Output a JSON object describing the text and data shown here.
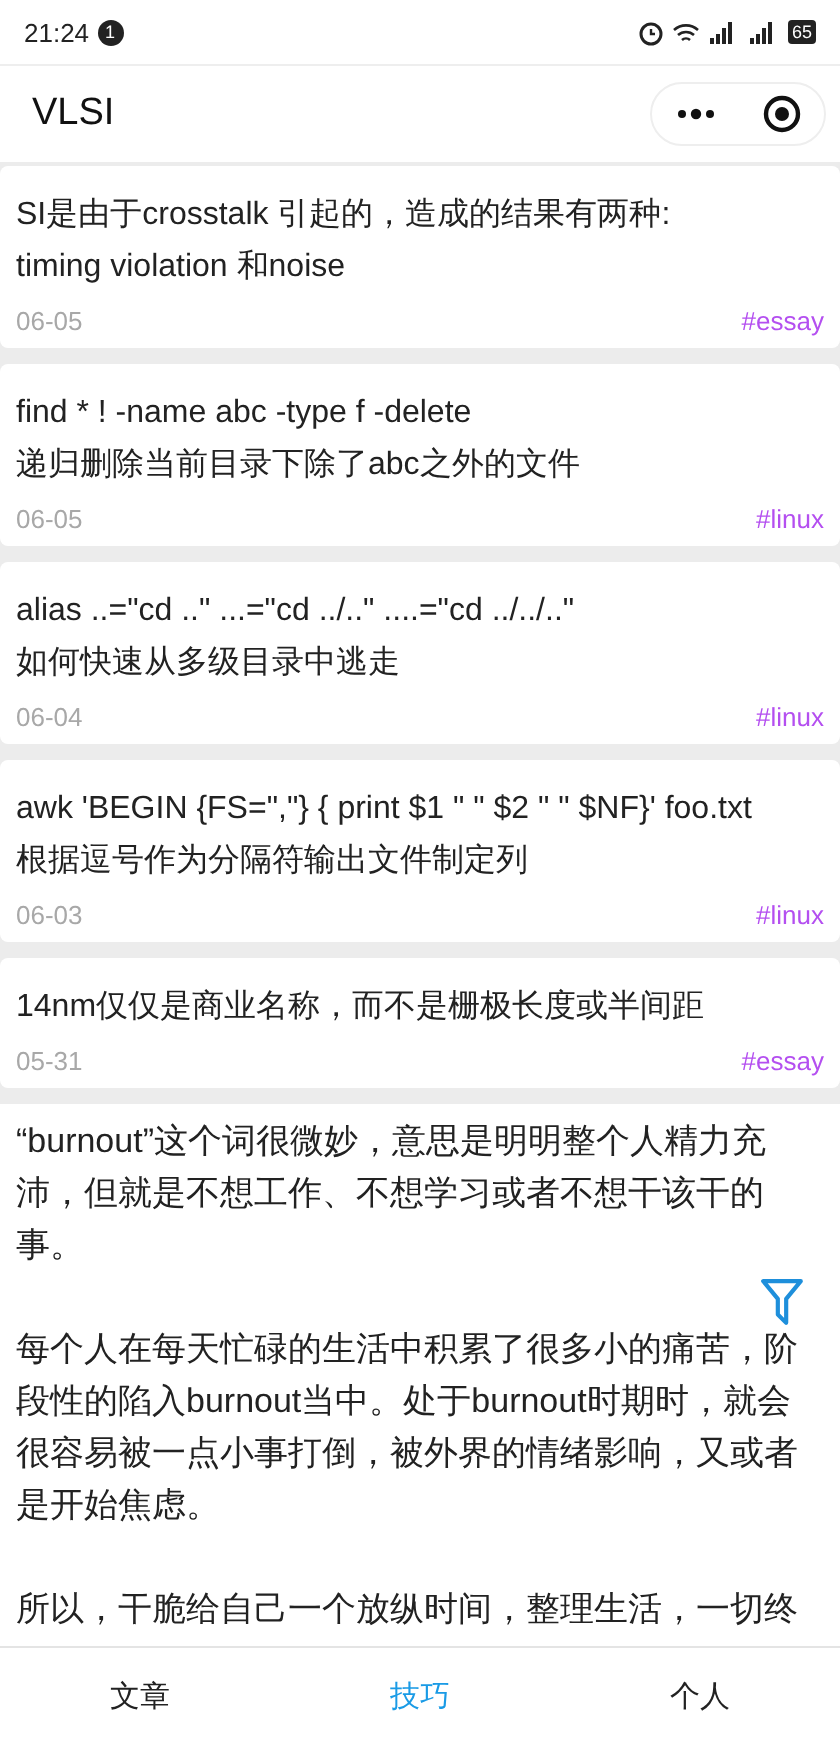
{
  "status_bar": {
    "time": "21:24",
    "notification_count": "1",
    "battery": "65"
  },
  "nav_bar": {
    "title": "VLSI"
  },
  "posts": [
    {
      "lines": [
        "SI是由于crosstalk 引起的，造成的结果有两种:",
        "timing violation 和noise"
      ],
      "date": "06-05",
      "tag": "#essay"
    },
    {
      "lines": [
        "find * ! -name abc -type f -delete",
        "递归删除当前目录下除了abc之外的文件"
      ],
      "date": "06-05",
      "tag": "#linux"
    },
    {
      "lines": [
        "alias ..=\"cd ..\" ...=\"cd ../..\" ....=\"cd ../../..\"",
        "如何快速从多级目录中逃走"
      ],
      "date": "06-04",
      "tag": "#linux"
    },
    {
      "lines": [
        "awk 'BEGIN {FS=\",\"} { print $1 \" \" $2 \" \" $NF}' foo.txt",
        "根据逗号作为分隔符输出文件制定列"
      ],
      "date": "06-03",
      "tag": "#linux"
    },
    {
      "lines": [
        "14nm仅仅是商业名称，而不是栅极长度或半间距"
      ],
      "date": "05-31",
      "tag": "#essay"
    }
  ],
  "essay": {
    "paragraphs": [
      "“burnout”这个词很微妙，意思是明明整个人精力充沛，但就是不想工作、不想学习或者不想干该干的事。",
      "每个人在每天忙碌的生活中积累了很多小的痛苦，阶段性的陷入burnout当中。处于burnout时期时，就会很容易被一点小事打倒，被外界的情绪影响，又或者是开始焦虑。",
      "所以，干脆给自己一个放纵时间，整理生活，一切终"
    ]
  },
  "tabs": [
    {
      "label": "文章",
      "selected": false
    },
    {
      "label": "技巧",
      "selected": true
    },
    {
      "label": "个人",
      "selected": false
    }
  ]
}
